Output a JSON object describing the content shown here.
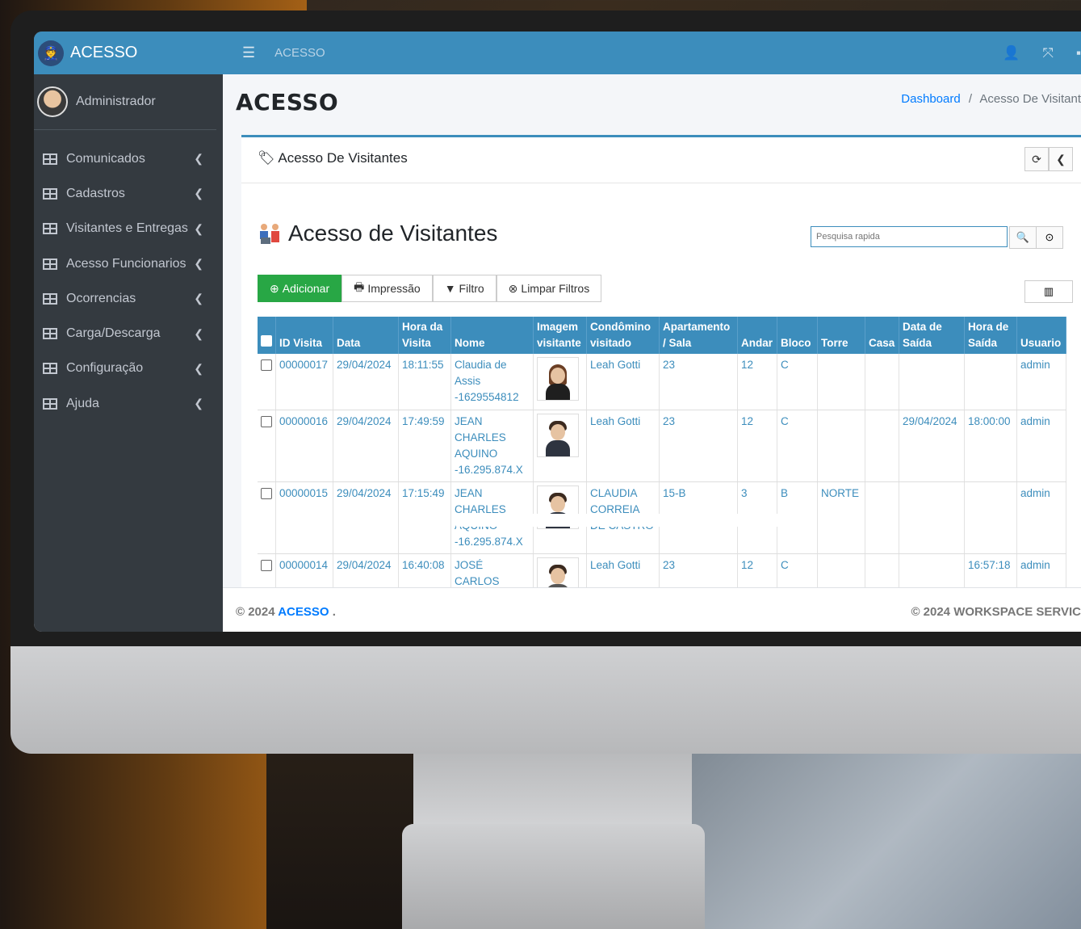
{
  "brand": {
    "title": "ACESSO"
  },
  "user": {
    "name": "Administrador"
  },
  "menu": [
    {
      "label": "Comunicados"
    },
    {
      "label": "Cadastros"
    },
    {
      "label": "Visitantes e Entregas"
    },
    {
      "label": "Acesso Funcionarios"
    },
    {
      "label": "Ocorrencias"
    },
    {
      "label": "Carga/Descarga"
    },
    {
      "label": "Configuração"
    },
    {
      "label": "Ajuda"
    }
  ],
  "topbar": {
    "title": "ACESSO"
  },
  "page": {
    "title": "ACESSO"
  },
  "breadcrumb": {
    "home": "Dashboard",
    "sep": "/",
    "current": "Acesso De Visitant"
  },
  "card": {
    "title": "Acesso De Visitantes"
  },
  "section": {
    "title": "Acesso de Visitantes"
  },
  "search": {
    "placeholder": "Pesquisa rapida"
  },
  "toolbar": {
    "add": "Adicionar",
    "print": "Impressão",
    "filter": "Filtro",
    "clear": "Limpar Filtros"
  },
  "table": {
    "headers": [
      "ID Visita",
      "Data",
      "Hora da Visita",
      "Nome",
      "Imagem visitante",
      "Condômino visitado",
      "Apartamento / Sala",
      "Andar",
      "Bloco",
      "Torre",
      "Casa",
      "Data de Saída",
      "Hora de Saída",
      "Usuario"
    ],
    "rows": [
      {
        "id": "00000017",
        "data": "29/04/2024",
        "hora": "18:11:55",
        "nome": "Claudia de Assis -1629554812",
        "photo": "female-visitor",
        "condomino": "Leah Gotti",
        "apto": "23",
        "andar": "12",
        "bloco": "C",
        "torre": "",
        "casa": "",
        "data_saida": "",
        "hora_saida": "",
        "usuario": "admin"
      },
      {
        "id": "00000016",
        "data": "29/04/2024",
        "hora": "17:49:59",
        "nome": "JEAN CHARLES AQUINO -16.295.874.X",
        "photo": "male-visitor",
        "condomino": "Leah Gotti",
        "apto": "23",
        "andar": "12",
        "bloco": "C",
        "torre": "",
        "casa": "",
        "data_saida": "29/04/2024",
        "hora_saida": "18:00:00",
        "usuario": "admin"
      },
      {
        "id": "00000015",
        "data": "29/04/2024",
        "hora": "17:15:49",
        "nome": "JEAN CHARLES AQUINO -16.295.874.X",
        "photo": "male-visitor",
        "condomino": "CLAUDIA CORREIA DE CASTRO",
        "apto": "15-B",
        "andar": "3",
        "bloco": "B",
        "torre": "NORTE",
        "casa": "",
        "data_saida": "",
        "hora_saida": "",
        "usuario": "admin"
      },
      {
        "id": "00000014",
        "data": "29/04/2024",
        "hora": "16:40:08",
        "nome": "JOSÉ CARLOS",
        "photo": "male-visitor-2",
        "condomino": "Leah Gotti",
        "apto": "23",
        "andar": "12",
        "bloco": "C",
        "torre": "",
        "casa": "",
        "data_saida": "",
        "hora_saida": "16:57:18",
        "usuario": "admin"
      }
    ]
  },
  "footer": {
    "left_prefix": "© 2024",
    "left_link": "ACESSO",
    "left_suffix": ".",
    "right": "© 2024 WORKSPACE SERVIC"
  },
  "colors": {
    "primary": "#3c8dbc",
    "sidebar": "#343a40",
    "success": "#28a745",
    "link": "#007bff"
  }
}
